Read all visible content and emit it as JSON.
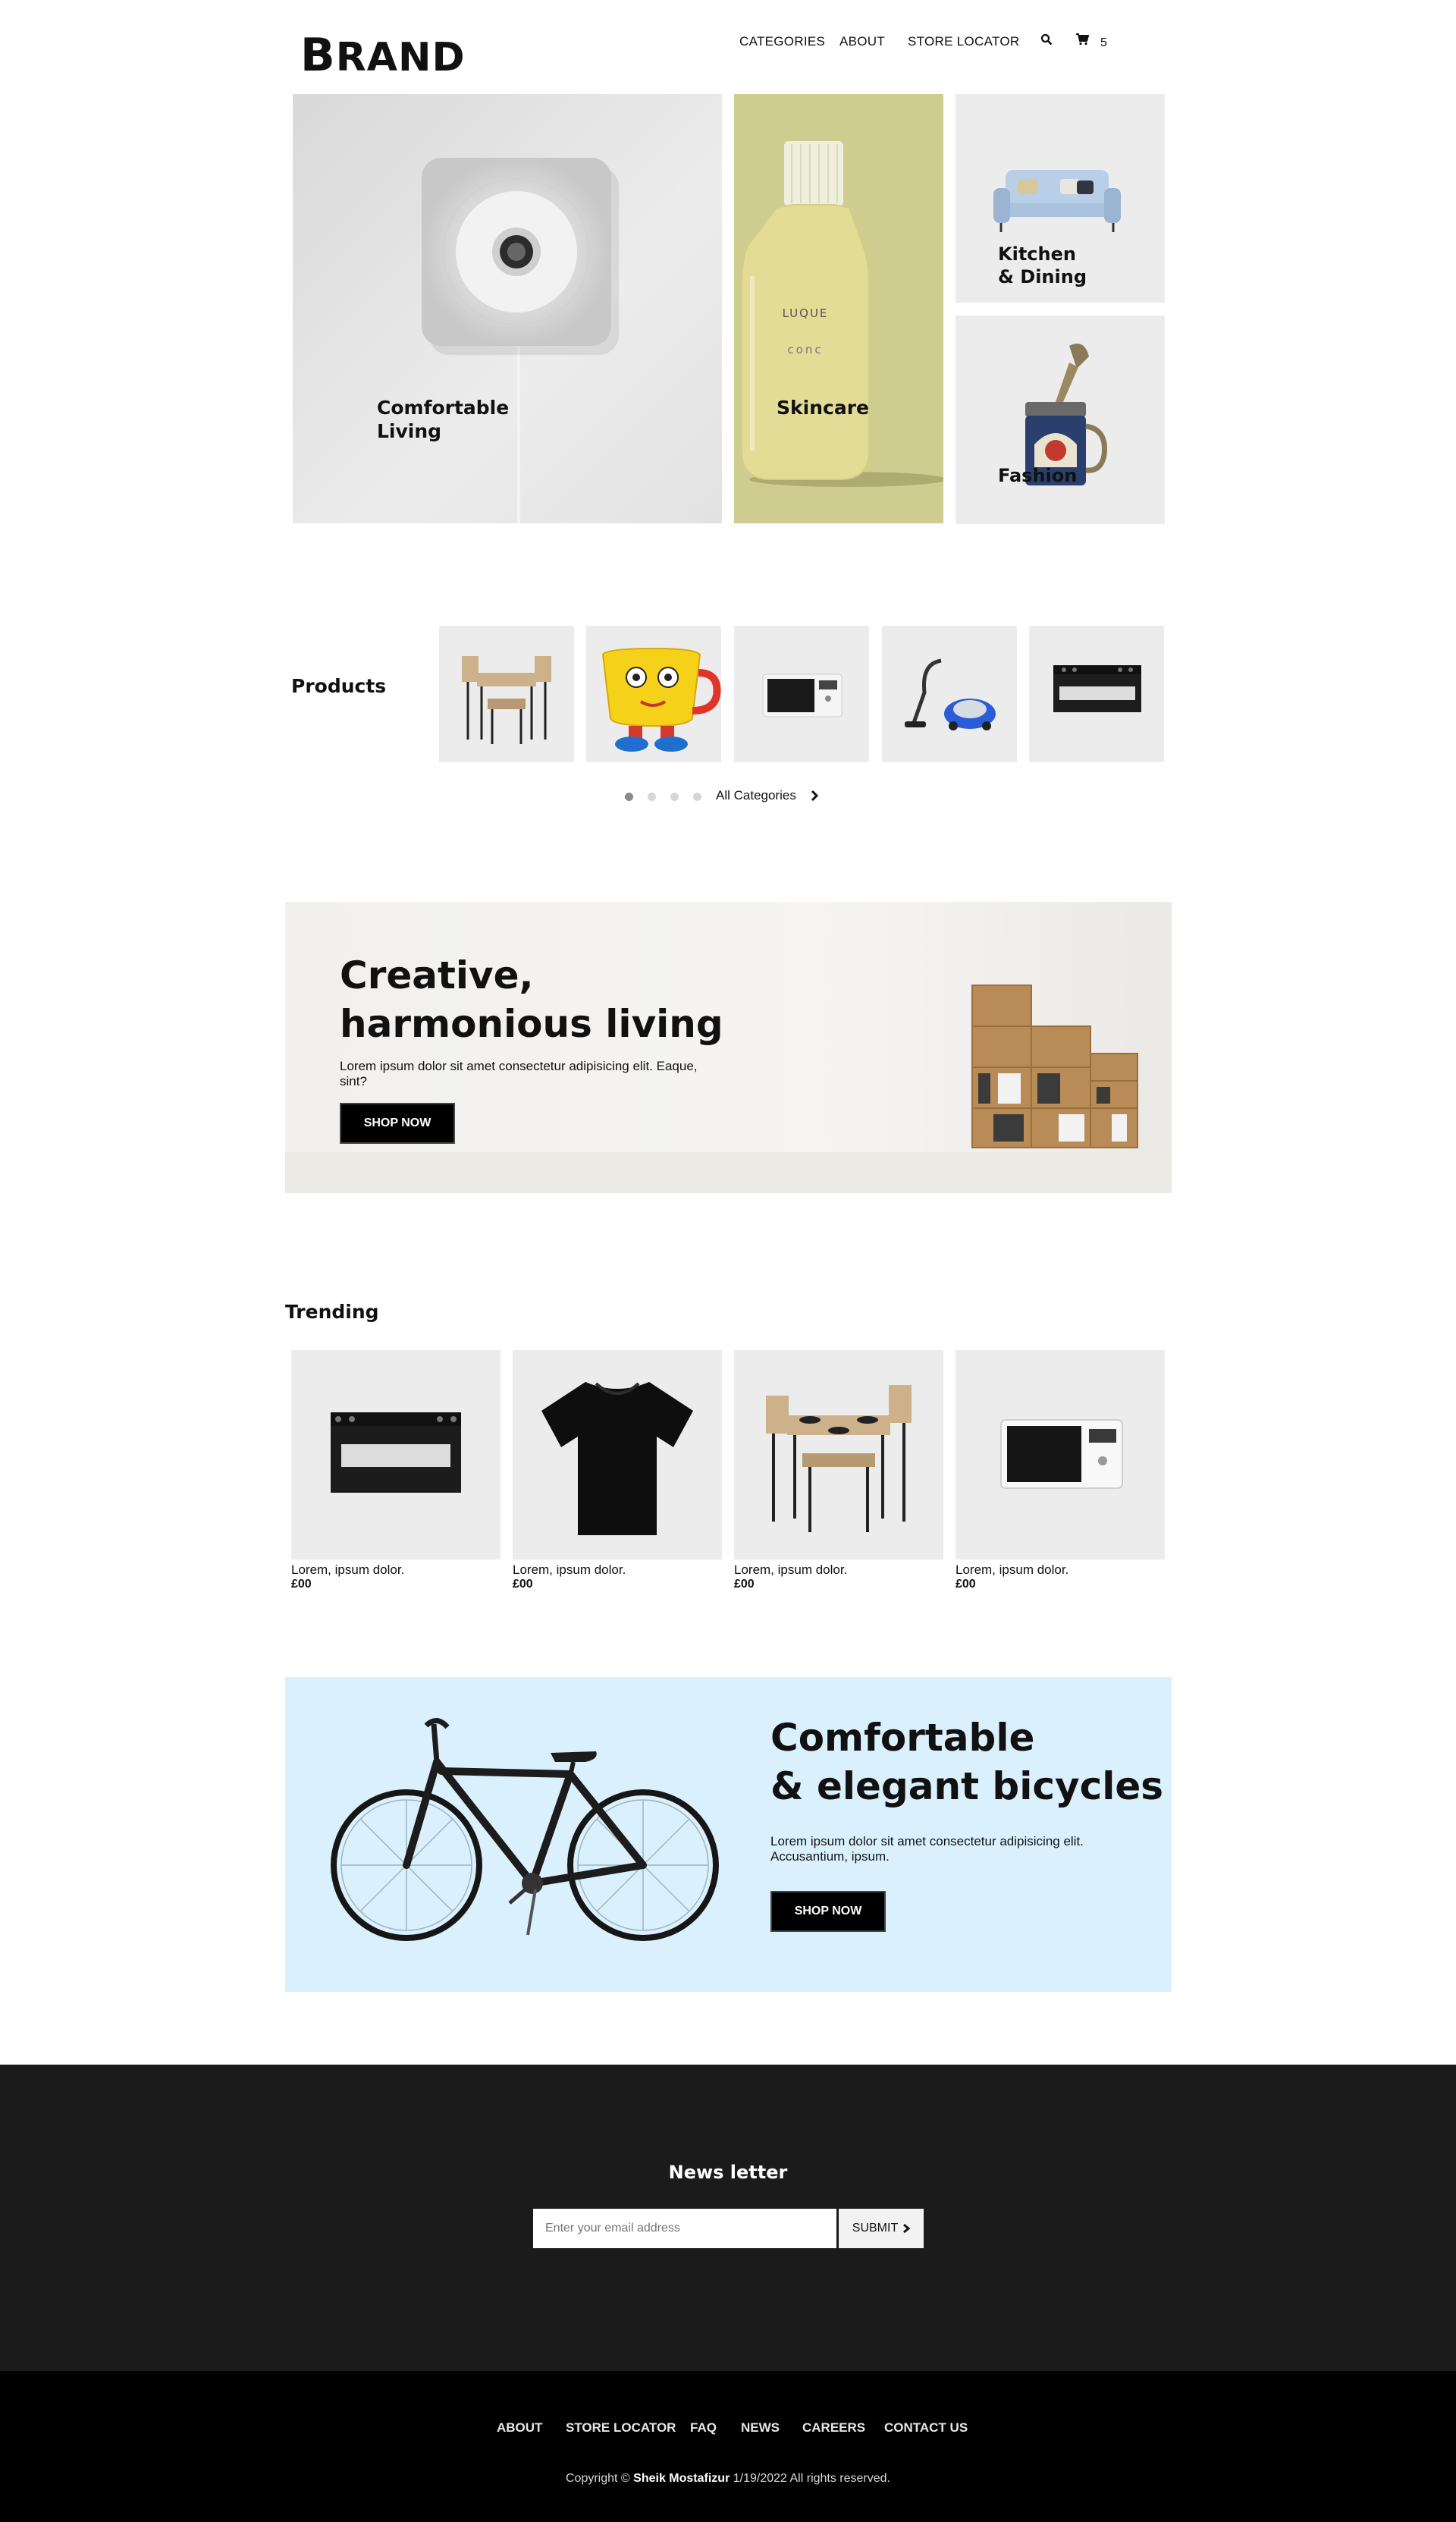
{
  "header": {
    "brand_first": "B",
    "brand_rest": "RAND",
    "nav": [
      "CATEGORIES",
      "ABOUT",
      "STORE LOCATOR"
    ],
    "cart_count": "5"
  },
  "hero": {
    "tiles": [
      {
        "label_line1": "Comfortable",
        "label_line2": "Living"
      },
      {
        "label_line1": "Skincare"
      },
      {
        "label_line1": "Kitchen",
        "label_line2": "& Dining"
      },
      {
        "label_line1": "Fashion"
      }
    ],
    "bottle_text": [
      "LUQUE",
      "conc"
    ]
  },
  "products": {
    "title": "Products",
    "all_categories": "All Categories",
    "items": [
      "dining-set",
      "cup-figure",
      "microwave",
      "vacuum-cleaner",
      "stove"
    ]
  },
  "banner1": {
    "title_line1": "Creative,",
    "title_line2": "harmonious living",
    "text": "Lorem ipsum dolor sit amet consectetur adipisicing elit. Eaque, sint?",
    "button": "SHOP NOW"
  },
  "trending": {
    "title": "Trending",
    "items": [
      {
        "name": "Lorem, ipsum dolor.",
        "price": "£00"
      },
      {
        "name": "Lorem, ipsum dolor.",
        "price": "£00"
      },
      {
        "name": "Lorem, ipsum dolor.",
        "price": "£00"
      },
      {
        "name": "Lorem, ipsum dolor.",
        "price": "£00"
      }
    ]
  },
  "banner2": {
    "title_line1": "Comfortable",
    "title_line2": "& elegant bicycles",
    "text": "Lorem ipsum dolor sit amet consectetur adipisicing elit. Accusantium, ipsum.",
    "button": "SHOP NOW"
  },
  "newsletter": {
    "title": "News letter",
    "placeholder": "Enter your email address",
    "submit": "SUBMIT"
  },
  "footer": {
    "links": [
      "ABOUT",
      "STORE LOCATOR",
      "FAQ",
      "NEWS",
      "CAREERS",
      "CONTACT US"
    ],
    "copyright_prefix": "Copyright ©",
    "author": "Sheik Mostafizur",
    "copyright_suffix": "1/19/2022 All rights reserved."
  },
  "colors": {
    "tile_gray": "#ececec",
    "skincare_bg": "#cfcc8f",
    "bicycle_bg": "#daf1fd",
    "footer_dark": "#1b1b1b",
    "footer_black": "#000000"
  }
}
